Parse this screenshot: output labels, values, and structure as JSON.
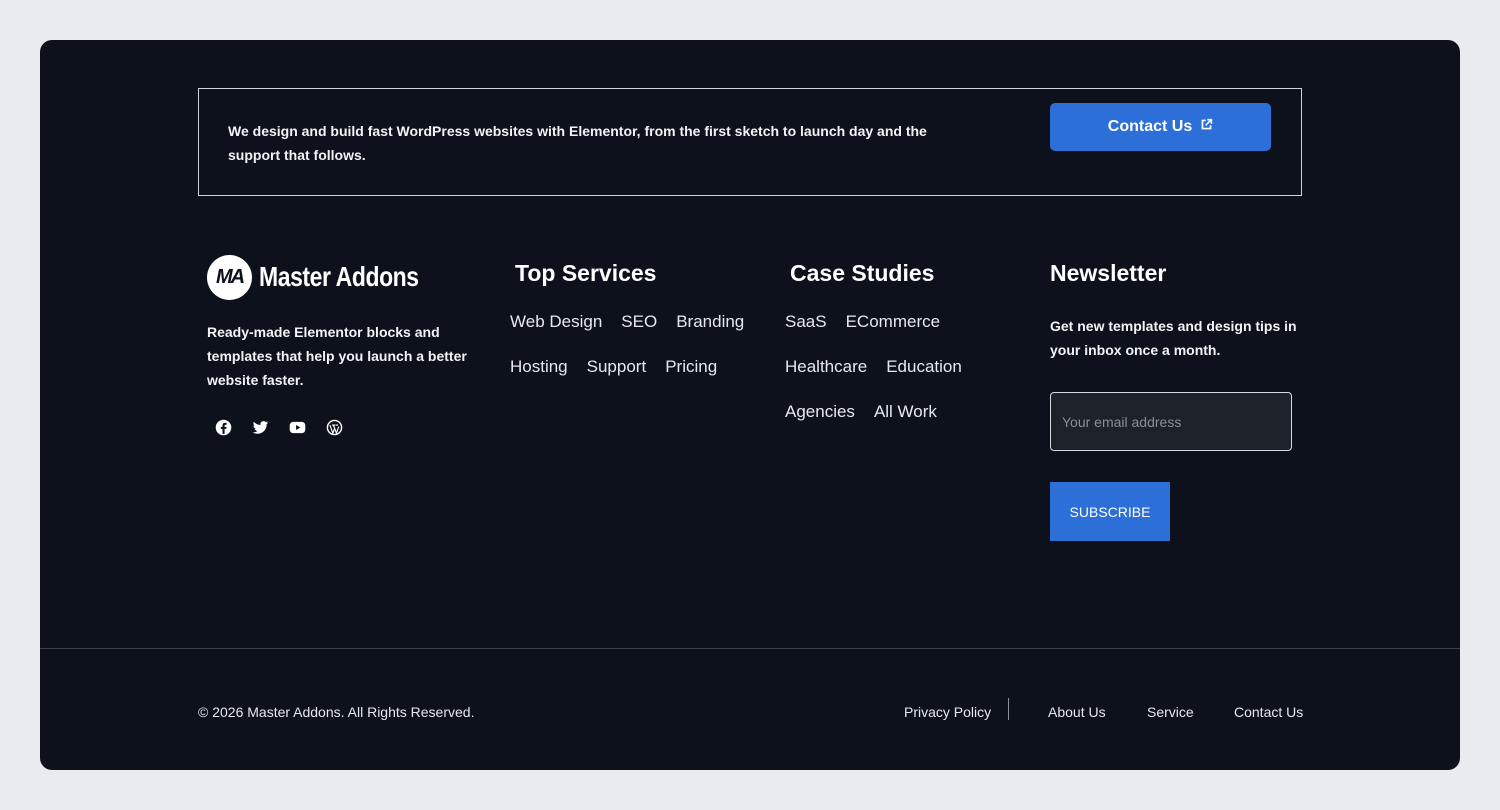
{
  "cta": {
    "text": "We design and build fast WordPress websites with Elementor, from the first sketch to launch day and the support that follows.",
    "button_label": "Contact Us",
    "button_icon": "external-link-icon"
  },
  "brand": {
    "logo_mark": "MA",
    "name": "Master Addons",
    "description": "Ready-made Elementor blocks and templates that help you launch a better website faster.",
    "social_icons": [
      "facebook-icon",
      "twitter-icon",
      "youtube-icon",
      "wordpress-icon"
    ]
  },
  "top_services": {
    "title": "Top Services",
    "links": [
      "Web Design",
      "SEO",
      "Branding",
      "Hosting",
      "Support",
      "Pricing"
    ]
  },
  "case_studies": {
    "title": "Case Studies",
    "links": [
      "SaaS",
      "ECommerce",
      "Healthcare",
      "Education",
      "Agencies",
      "All Work"
    ]
  },
  "newsletter": {
    "title": "Newsletter",
    "description": "Get new templates and design tips in your inbox once a month.",
    "input_placeholder": "Your email address",
    "button_label": "SUBSCRIBE"
  },
  "bottom": {
    "copyright": "© 2026 Master Addons. All Rights Reserved.",
    "links": [
      "Privacy Policy",
      "About Us",
      "Service",
      "Contact Us"
    ]
  },
  "colors": {
    "background": "#0d111b",
    "accent": "#2d6fd8",
    "page": "#e8ebef"
  }
}
